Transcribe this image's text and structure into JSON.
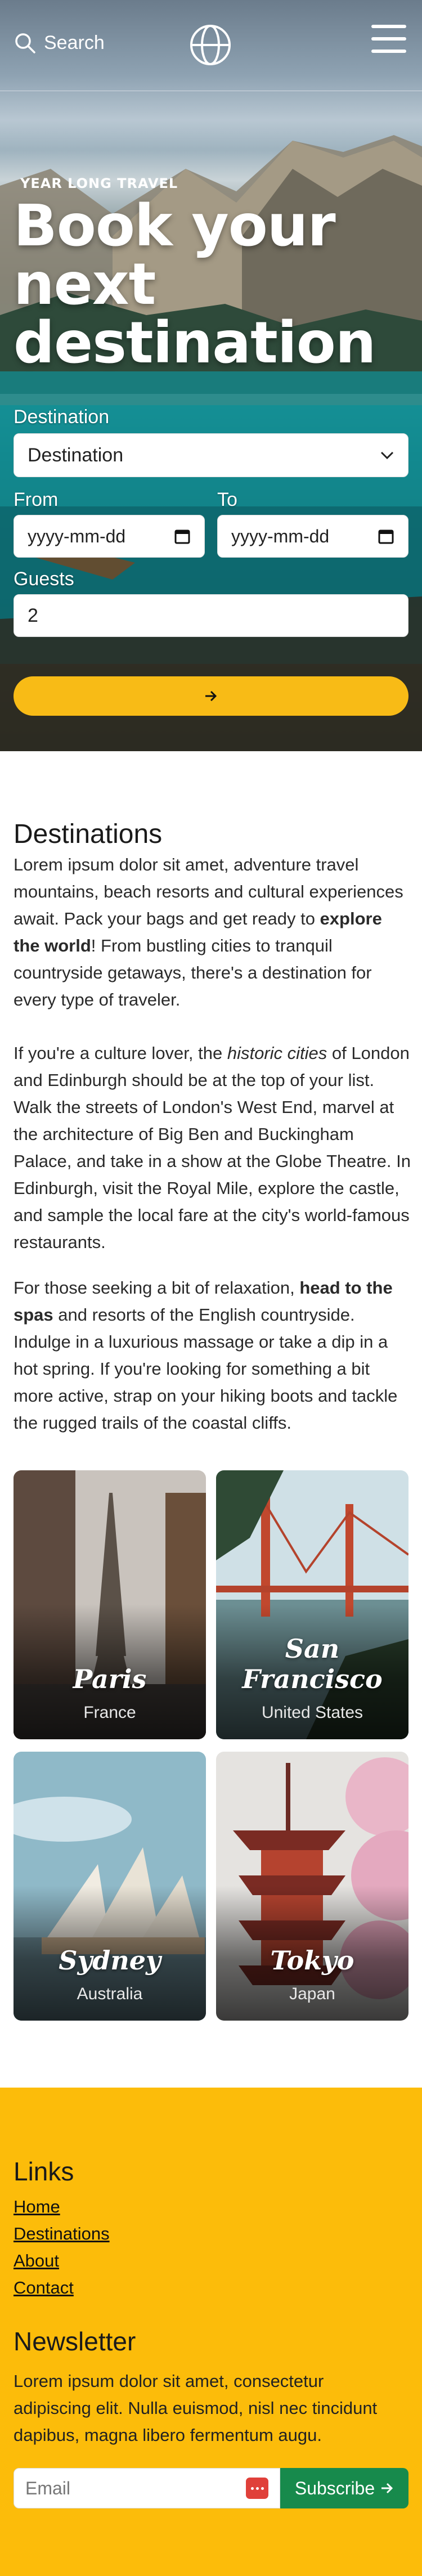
{
  "header": {
    "search_label": "Search",
    "icons": {
      "search": "search-icon",
      "logo": "globe-icon",
      "menu": "hamburger-icon"
    }
  },
  "hero": {
    "eyebrow": "YEAR LONG TRAVEL",
    "title": "Book your next destination",
    "destination_label": "Destination",
    "destination_value": "Destination",
    "from_label": "From",
    "from_placeholder": "yyyy-mm-dd",
    "to_label": "To",
    "to_placeholder": "yyyy-mm-dd",
    "guests_label": "Guests",
    "guests_value": "2",
    "submit_icon": "arrow-right-icon"
  },
  "destinations": {
    "title": "Destinations",
    "p1a": "Lorem ipsum dolor sit amet, adventure travel mountains, beach resorts and cultural experiences await. Pack your bags and get ready to ",
    "p1b": "explore the world",
    "p1c": "! From bustling cities to tranquil countryside getaways, there's a destination for every type of traveler.",
    "p2a": "If you're a culture lover, the ",
    "p2b": "historic cities",
    "p2c": " of London and Edinburgh should be at the top of your list. Walk the streets of London's West End, marvel at the architecture of Big Ben and Buckingham Palace, and take in a show at the Globe Theatre. In Edinburgh, visit the Royal Mile, explore the castle, and sample the local fare at the city's world-famous restaurants.",
    "p3a": "For those seeking a bit of relaxation, ",
    "p3b": "head to the spas",
    "p3c": " and resorts of the English countryside. Indulge in a luxurious massage or take a dip in a hot spring. If you're looking for something a bit more active, strap on your hiking boots and tackle the rugged trails of the coastal cliffs.",
    "cards": [
      {
        "city": "Paris",
        "country": "France"
      },
      {
        "city": "San Francisco",
        "country": "United States"
      },
      {
        "city": "Sydney",
        "country": "Australia"
      },
      {
        "city": "Tokyo",
        "country": "Japan"
      }
    ]
  },
  "footer": {
    "links_title": "Links",
    "links": [
      "Home",
      "Destinations",
      "About",
      "Contact"
    ],
    "newsletter_title": "Newsletter",
    "newsletter_text": "Lorem ipsum dolor sit amet, consectetur adipiscing elit. Nulla euismod, nisl nec tincidunt dapibus, magna libero fermentum augu.",
    "email_placeholder": "Email",
    "subscribe_label": "Subscribe",
    "colors": {
      "footer_bg": "#fcbc0a",
      "subscribe_bg": "#178a4c",
      "cta_bg": "#f8bb16"
    }
  }
}
